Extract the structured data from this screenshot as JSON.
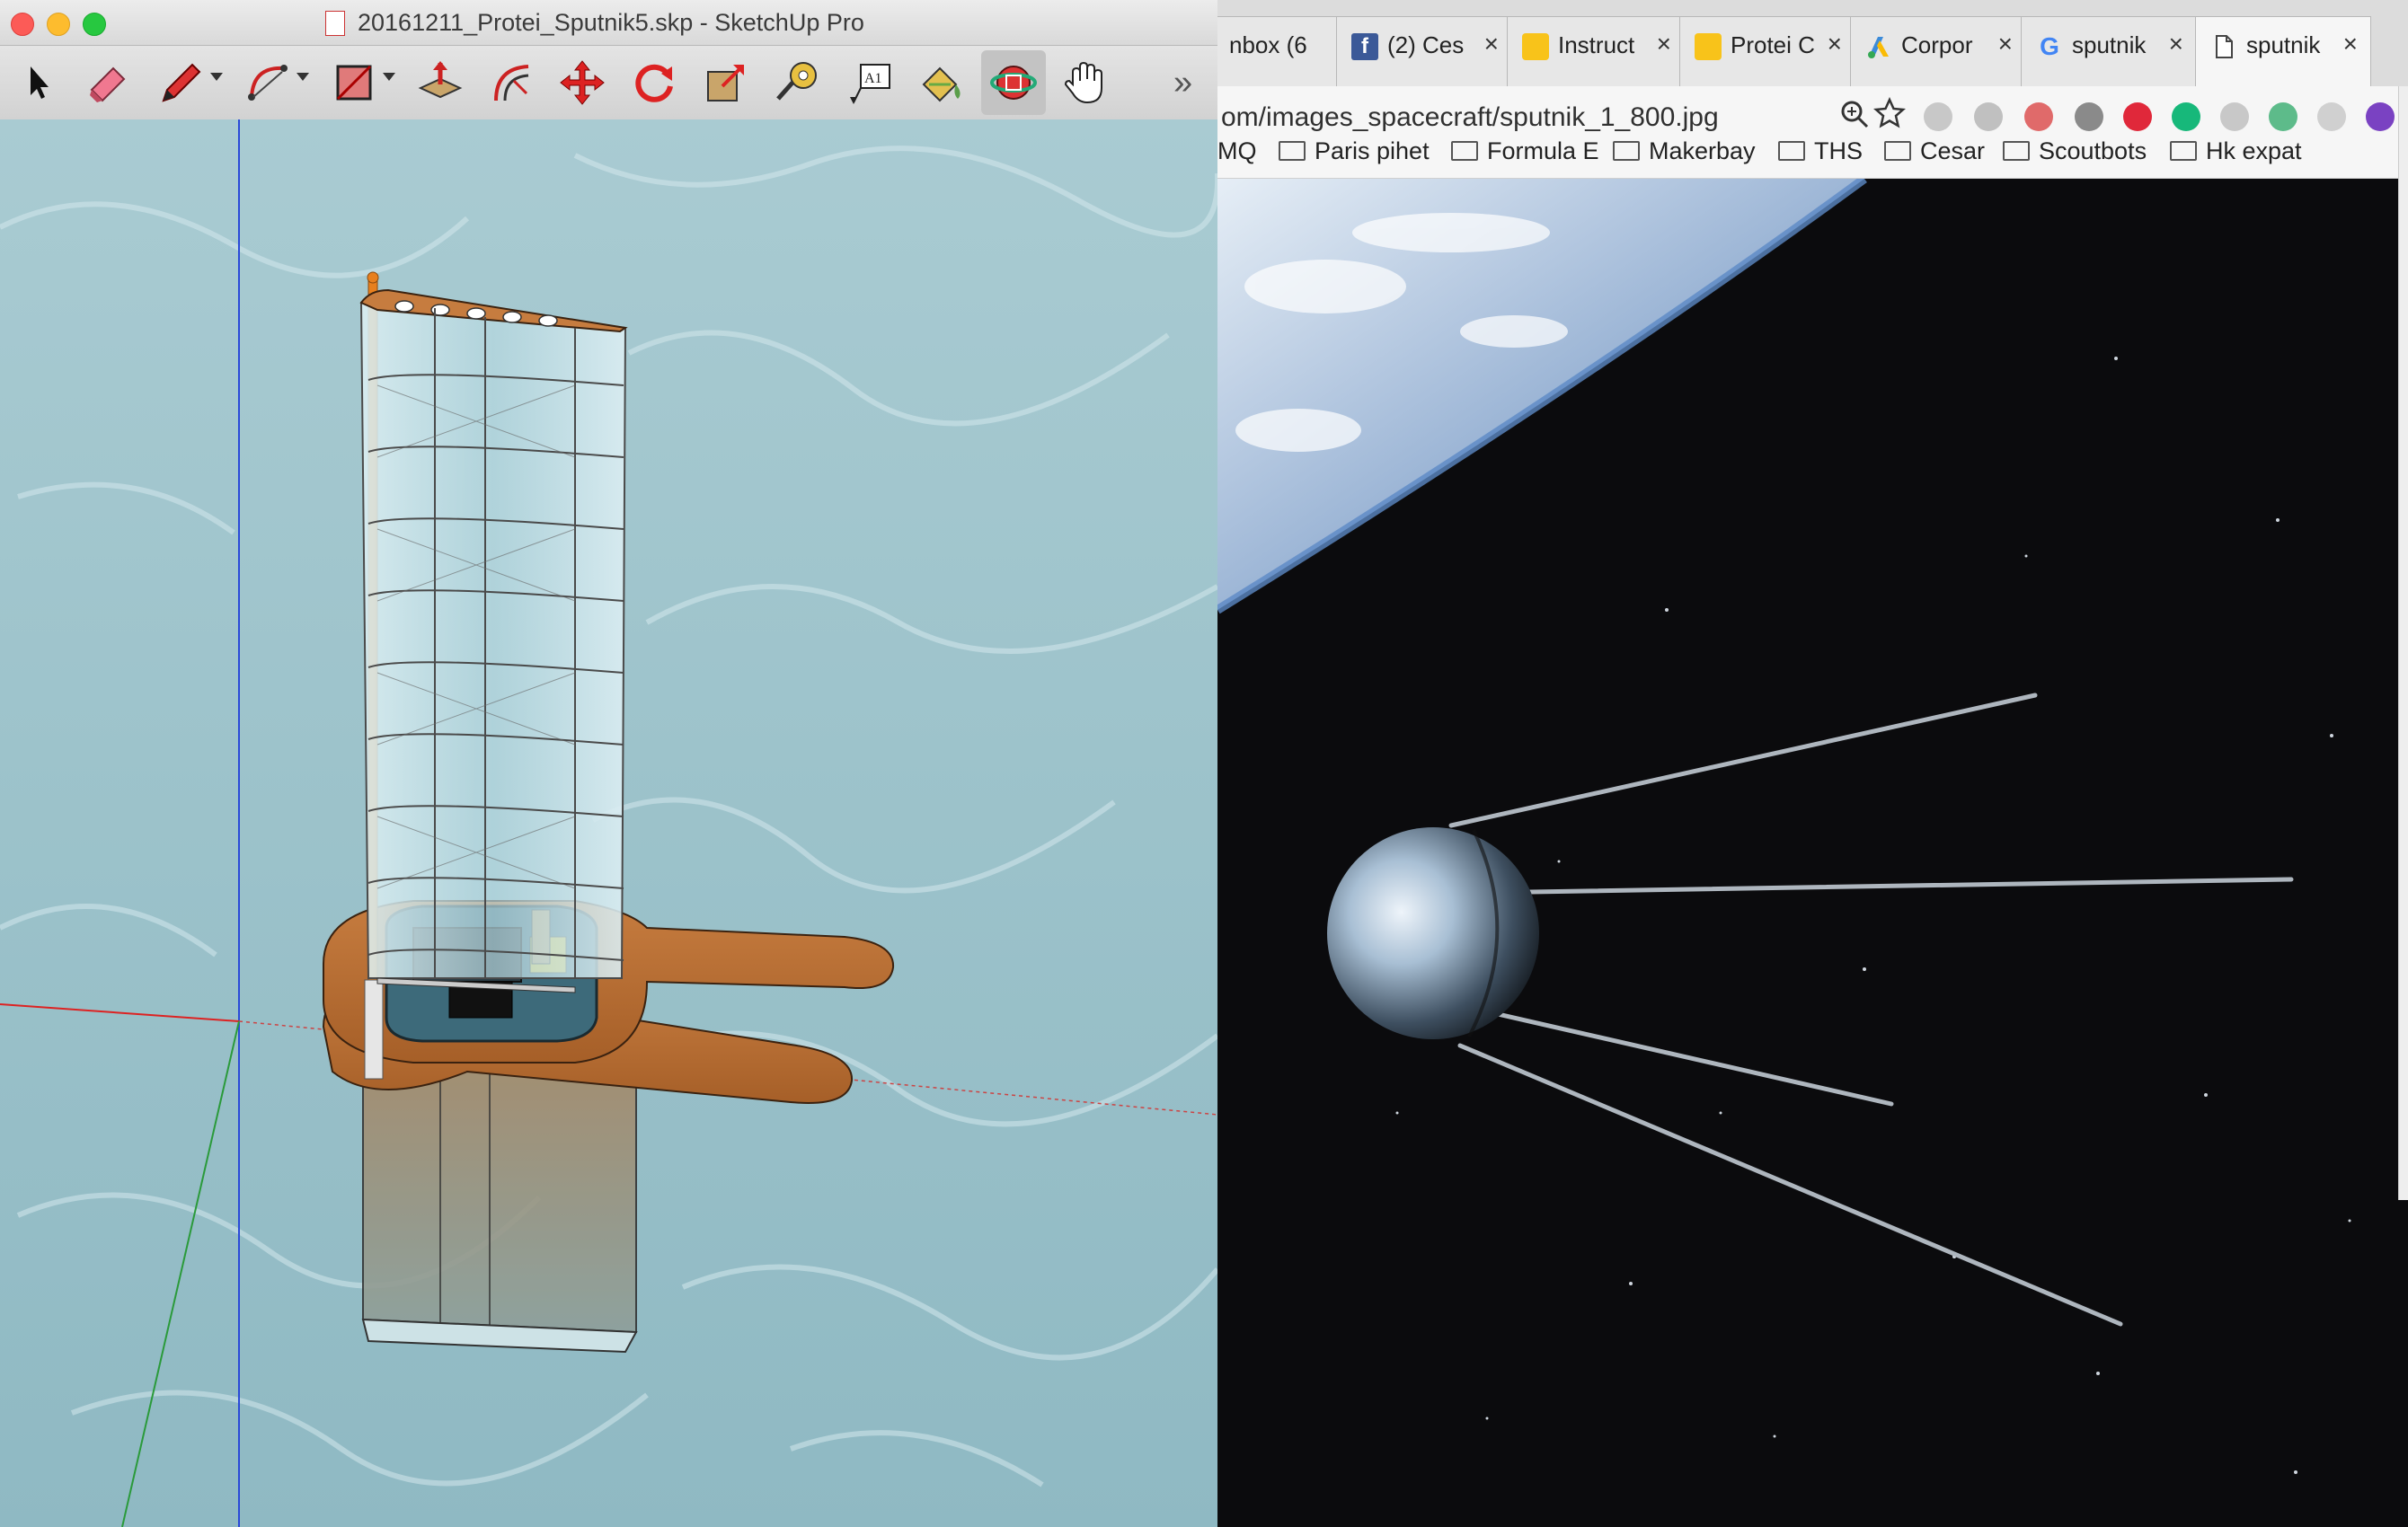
{
  "sketchup": {
    "window_title": "20161211_Protei_Sputnik5.skp - SketchUp Pro",
    "overflow_label": "»",
    "tools": [
      {
        "name": "select",
        "icon": "arrow-cursor-icon",
        "dropdown": false
      },
      {
        "name": "eraser",
        "icon": "eraser-icon",
        "dropdown": false
      },
      {
        "name": "line",
        "icon": "pencil-icon",
        "dropdown": true
      },
      {
        "name": "arc",
        "icon": "arc-icon",
        "dropdown": true
      },
      {
        "name": "rectangle",
        "icon": "rectangle-icon",
        "dropdown": true
      },
      {
        "name": "push-pull",
        "icon": "push-pull-icon",
        "dropdown": false
      },
      {
        "name": "offset",
        "icon": "offset-icon",
        "dropdown": false
      },
      {
        "name": "move",
        "icon": "move-icon",
        "dropdown": false
      },
      {
        "name": "rotate",
        "icon": "rotate-icon",
        "dropdown": false
      },
      {
        "name": "scale",
        "icon": "scale-icon",
        "dropdown": false
      },
      {
        "name": "tape-measure",
        "icon": "tape-measure-icon",
        "dropdown": false
      },
      {
        "name": "text",
        "icon": "text-tool-icon",
        "dropdown": false
      },
      {
        "name": "paint-bucket",
        "icon": "paint-bucket-icon",
        "dropdown": false
      },
      {
        "name": "orbit",
        "icon": "orbit-icon",
        "dropdown": false,
        "active": true
      },
      {
        "name": "pan",
        "icon": "hand-pan-icon",
        "dropdown": false
      }
    ],
    "text_tool_glyph": "A1"
  },
  "chrome": {
    "tabs": [
      {
        "label": "nbox (6",
        "icon": "gmail-tab-icon"
      },
      {
        "label": "(2) Ces",
        "icon": "facebook-tab-icon"
      },
      {
        "label": "Instruct",
        "icon": "instructables-tab-icon"
      },
      {
        "label": "Protei C",
        "icon": "instructables-tab-icon"
      },
      {
        "label": "Corpor",
        "icon": "adwords-tab-icon"
      },
      {
        "label": "sputnik",
        "icon": "google-tab-icon"
      },
      {
        "label": "sputnik",
        "icon": "document-tab-icon",
        "active": true
      }
    ],
    "close_glyph": "×",
    "url": "om/images_spacecraft/sputnik_1_800.jpg",
    "bookmarks": [
      "MQ",
      "Paris pihet",
      "Formula E",
      "Makerbay",
      "THS",
      "Cesar",
      "Scoutbots",
      "Hk expat"
    ]
  },
  "colors": {
    "sail_frame": "#4a4a4a",
    "hull_wood": "#b8713a",
    "mast_orange": "#e8801e",
    "sky_water": "#9dc3cb",
    "space": "#0b0b0d",
    "earth_blue": "#5d89c6"
  }
}
